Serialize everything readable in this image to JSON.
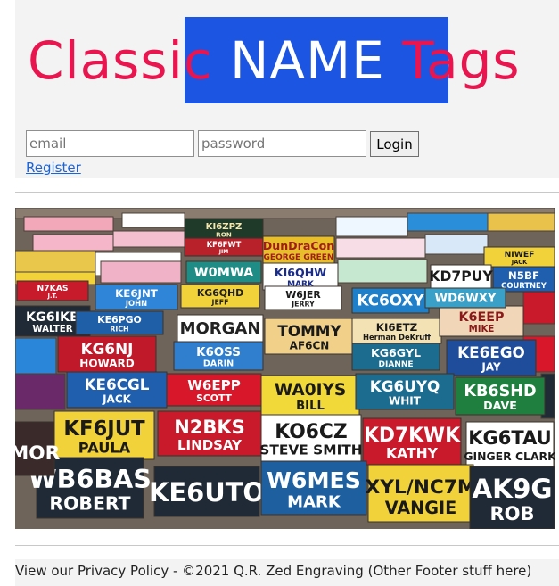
{
  "header": {
    "title_part1": "Classi",
    "title_part2": "c",
    "title_part3": " NAME ",
    "title_part4": "T",
    "title_part5": "ags"
  },
  "login": {
    "email_placeholder": "email",
    "password_placeholder": "password",
    "login_label": "Login",
    "register_label": "Register"
  },
  "photo": {
    "tags": [
      {
        "line1": "KI6ZPZ",
        "line2": "RON"
      },
      {
        "line1": "KF6FWT",
        "line2": "JIM"
      },
      {
        "line1": "DunDraCon",
        "line2": "GEORGE GREEN"
      },
      {
        "line1": "W0MWA",
        "line2": ""
      },
      {
        "line1": "KI6QHW",
        "line2": "MARK"
      },
      {
        "line1": "KG6QHD",
        "line2": "JEFF"
      },
      {
        "line1": "W6JER",
        "line2": "JERRY"
      },
      {
        "line1": "KE6JNT",
        "line2": "JOHN"
      },
      {
        "line1": "N7KAS",
        "line2": "J.T."
      },
      {
        "line1": "KG6IKB",
        "line2": "WALTER"
      },
      {
        "line1": "KE6PGO",
        "line2": "RICH"
      },
      {
        "line1": "MORGAN",
        "line2": ""
      },
      {
        "line1": "TOMMY",
        "line2": "AF6CN"
      },
      {
        "line1": "KI6ETZ",
        "line2": "Herman DeKruff"
      },
      {
        "line1": "K6EEP",
        "line2": "MIKE"
      },
      {
        "line1": "KG6NJ",
        "line2": "HOWARD"
      },
      {
        "line1": "K6OSS",
        "line2": "DARIN"
      },
      {
        "line1": "KG6GYL",
        "line2": "DIANNE"
      },
      {
        "line1": "KE6EGO",
        "line2": "JAY"
      },
      {
        "line1": "KE6CGL",
        "line2": "JACK"
      },
      {
        "line1": "W6EPP",
        "line2": "SCOTT"
      },
      {
        "line1": "WA0IYS",
        "line2": "BILL"
      },
      {
        "line1": "KG6UYQ",
        "line2": "WHIT"
      },
      {
        "line1": "KB6SHD",
        "line2": "DAVE"
      },
      {
        "line1": "KF6JUT",
        "line2": "PAULA"
      },
      {
        "line1": "N2BKS",
        "line2": "LINDSAY"
      },
      {
        "line1": "KO6CZ",
        "line2": "STEVE SMITH"
      },
      {
        "line1": "KD7KWK",
        "line2": "KATHY"
      },
      {
        "line1": "KG6TAU",
        "line2": "GINGER CLARK"
      },
      {
        "line1": "WB6BAS",
        "line2": "ROBERT"
      },
      {
        "line1": "KE6UTO",
        "line2": ""
      },
      {
        "line1": "W6MES",
        "line2": "MARK"
      },
      {
        "line1": "XYL/NC7M",
        "line2": "VANGIE"
      },
      {
        "line1": "AK9G",
        "line2": "ROB"
      },
      {
        "line1": "MOR",
        "line2": ""
      },
      {
        "line1": "NIWEF",
        "line2": "JACK"
      },
      {
        "line1": "N5BF",
        "line2": "COURTNEY"
      },
      {
        "line1": "KC6OXY",
        "line2": ""
      },
      {
        "line1": "KD7PUY",
        "line2": ""
      },
      {
        "line1": "WD6WXY",
        "line2": ""
      }
    ]
  },
  "footer": {
    "text": "View our Privacy Policy - ©2021 Q.R. Zed Engraving (Other Footer stuff here)"
  },
  "colors": {
    "title_red": "#e8154f",
    "title_blue_box": "#1b55e2",
    "link_blue": "#1a63d8"
  }
}
